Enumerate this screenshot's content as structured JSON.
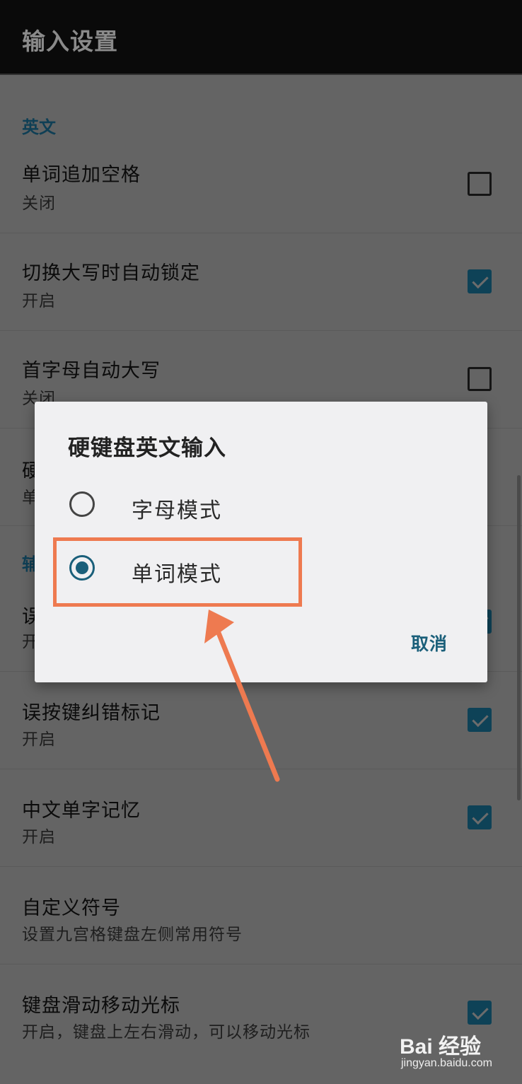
{
  "appbar": {
    "title": "输入设置"
  },
  "sections": {
    "english": "英文"
  },
  "settings": [
    {
      "title": "单词追加空格",
      "subtitle": "关闭",
      "checked": false
    },
    {
      "title": "切换大写时自动锁定",
      "subtitle": "开启",
      "checked": true
    },
    {
      "title": "首字母自动大写",
      "subtitle": "关闭",
      "checked": false
    },
    {
      "title": "误按键纠错标记",
      "subtitle": "开启",
      "checked": true
    },
    {
      "title": "中文单字记忆",
      "subtitle": "开启",
      "checked": true
    },
    {
      "title": "自定义符号",
      "subtitle": "设置九宫格键盘左侧常用符号"
    },
    {
      "title": "键盘滑动移动光标",
      "subtitle": "开启，键盘上左右滑动，可以移动光标",
      "checked": true
    }
  ],
  "partial_under_dialog": {
    "row_title": "硬",
    "row_subtitle": "单",
    "section": "辅",
    "row2_title": "误",
    "row2_subtitle": "开"
  },
  "dialog": {
    "title": "硬键盘英文输入",
    "options": [
      {
        "label": "字母模式",
        "selected": false
      },
      {
        "label": "单词模式",
        "selected": true
      }
    ],
    "cancel_label": "取消"
  },
  "annotation": {
    "highlight_color": "#ee7a50"
  },
  "watermark": {
    "brand": "Bai 经验",
    "url": "jingyan.baidu.com"
  },
  "colors": {
    "accent": "#1a5f7a",
    "checkbox_on": "#0e4257"
  }
}
